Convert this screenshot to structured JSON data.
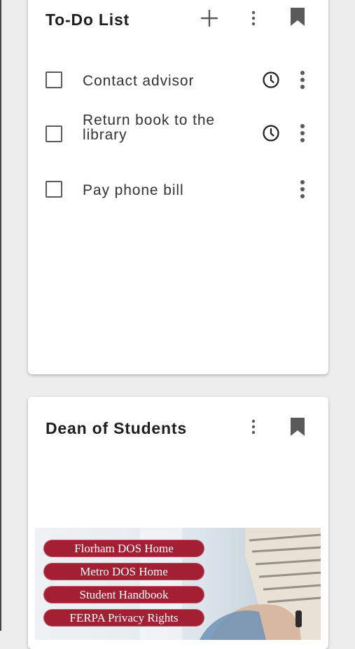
{
  "todo_card": {
    "title": "To-Do List",
    "items": [
      {
        "label": "Contact advisor",
        "has_reminder": true
      },
      {
        "label": "Return book to the library",
        "has_reminder": true
      },
      {
        "label": "Pay phone bill",
        "has_reminder": false
      }
    ],
    "icons": {
      "add": "plus-icon",
      "menu": "more-vertical-icon",
      "bookmark": "bookmark-icon",
      "reminder": "clock-icon"
    }
  },
  "dean_card": {
    "title": "Dean of Students",
    "links": [
      "Florham DOS Home",
      "Metro DOS Home",
      "Student Handbook",
      "FERPA Privacy Rights"
    ],
    "icons": {
      "menu": "more-vertical-icon",
      "bookmark": "bookmark-icon"
    }
  },
  "colors": {
    "page_background": "#ededed",
    "card_background": "#ffffff",
    "link_pill": "#a31f34",
    "icon": "#5a5a5a"
  }
}
